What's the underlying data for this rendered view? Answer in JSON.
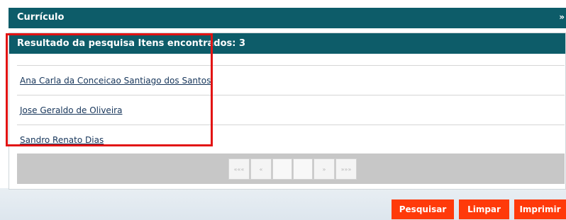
{
  "header": {
    "title": "Currículo",
    "collapse_glyph": "»"
  },
  "search_results": {
    "title": "Resultado da pesquisa Itens encontrados: 3",
    "items": [
      "Ana Carla da Conceicao Santiago dos Santos",
      "Jose Geraldo de Oliveira",
      "Sandro Renato Dias"
    ],
    "pager": {
      "first": "«««",
      "prev": "«",
      "next": "»",
      "last": "»»»"
    }
  },
  "actions": {
    "search": "Pesquisar",
    "clear": "Limpar",
    "print": "Imprimir"
  },
  "colors": {
    "header_bg": "#0d5c69",
    "button_bg": "#ff3a0a",
    "highlight": "#e21313"
  }
}
